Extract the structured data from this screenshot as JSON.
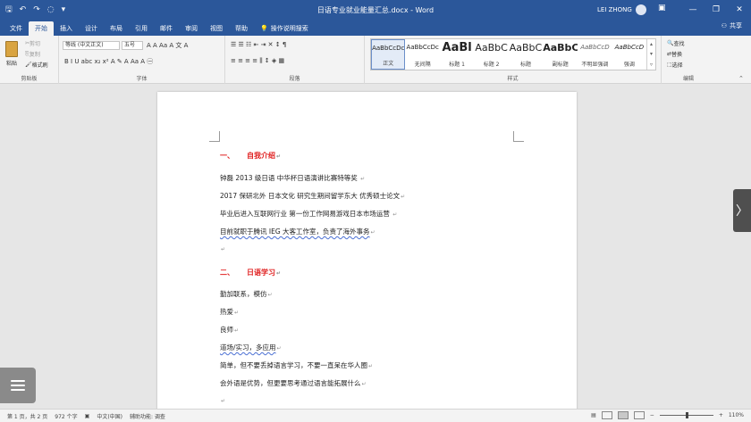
{
  "titlebar": {
    "qat": [
      "🖫",
      "↶",
      "↷",
      "◌",
      "▾"
    ],
    "doc_title": "日语专业就业能量汇总.docx - Word",
    "user": "LEI ZHONG",
    "win": {
      "ribbon": "▣",
      "min": "—",
      "max": "❐",
      "close": "✕"
    }
  },
  "tabs": {
    "items": [
      "文件",
      "开始",
      "插入",
      "设计",
      "布局",
      "引用",
      "邮件",
      "审阅",
      "视图",
      "帮助"
    ],
    "tell_me": "操作说明搜索",
    "share": "共享"
  },
  "ribbon": {
    "clipboard": {
      "label": "剪贴板",
      "paste": "粘贴",
      "cut": "剪切",
      "copy": "复制",
      "format_painter": "格式刷"
    },
    "font": {
      "label": "字体",
      "font_name": "等线 (中文正文)",
      "font_size": "五号",
      "row1": "A  A  Aa  A  文  A",
      "row2": "B  I  U  abc  x₂  x²  A  ✎  A  Aa  A  ㊀"
    },
    "paragraph": {
      "label": "段落",
      "row1": "☰  ☰  ☷  ⇤  ⇥  ✕  ↕  ¶",
      "row2": "≡  ≡  ≡  ≡  ⫼  ↕  ◈  ▦"
    },
    "styles": {
      "label": "样式",
      "items": [
        {
          "preview": "AaBbCcDc",
          "name": "正文"
        },
        {
          "preview": "AaBbCcDc",
          "name": "无间隔"
        },
        {
          "preview": "AaBl",
          "name": "标题 1"
        },
        {
          "preview": "AaBbC",
          "name": "标题 2"
        },
        {
          "preview": "AaBbC",
          "name": "标题"
        },
        {
          "preview": "AaBbC",
          "name": "副标题"
        },
        {
          "preview": "AaBbCcD",
          "name": "不明显强调"
        },
        {
          "preview": "AaBbCcD",
          "name": "强调"
        }
      ]
    },
    "editing": {
      "label": "编辑",
      "find": "查找",
      "replace": "替换",
      "select": "选择"
    }
  },
  "document": {
    "section1": {
      "num": "一、",
      "title": "自我介绍"
    },
    "lines1": [
      "钟磊 2013 级日语 中华杯日语演讲比赛特等奖 ",
      "2017 保研北外 日本文化 研究生期间留学东大 优秀硕士论文",
      "毕业后进入互联网行业 第一份工作网易游戏日本市场运营 ",
      "目前就职于腾讯 IEG 大客工作室，负责了海外事务"
    ],
    "section2": {
      "num": "二、",
      "title": "日语学习"
    },
    "lines2": [
      "勤加联系，模仿",
      "热爱",
      "良师",
      "道场/实习，多应用",
      "简单，但不要丢掉语言学习，不要一直呆在华人圈",
      "会外语是优势，但更要思考通过语言能拓展什么"
    ],
    "pmark": "↵"
  },
  "statusbar": {
    "page": "第 1 页，共 2 页",
    "words": "972 个字",
    "lang": "中文(中国)",
    "accessibility": "辅助功能: 调查",
    "zoom": "110%"
  },
  "icons": {
    "side_arrow": "〉",
    "search": "◯",
    "lightbulb": "💡"
  }
}
